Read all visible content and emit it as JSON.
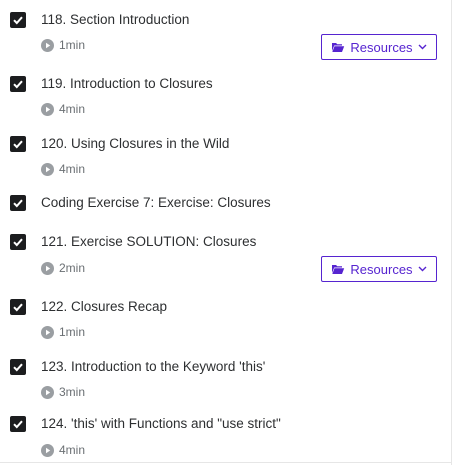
{
  "colors": {
    "checkbox": "#1c1d1f",
    "accent": "#5624d0",
    "muted": "#6a6f73",
    "text": "#2d2f31"
  },
  "resources_label": "Resources",
  "items": [
    {
      "title": "118. Section Introduction",
      "duration": "1min",
      "has_resources": true
    },
    {
      "title": "119. Introduction to Closures",
      "duration": "4min",
      "has_resources": false
    },
    {
      "title": "120. Using Closures in the Wild",
      "duration": "4min",
      "has_resources": false
    },
    {
      "title": "Coding Exercise 7: Exercise: Closures",
      "duration": "",
      "has_resources": false
    },
    {
      "title": "121. Exercise SOLUTION: Closures",
      "duration": "2min",
      "has_resources": true
    },
    {
      "title": "122. Closures Recap",
      "duration": "1min",
      "has_resources": false
    },
    {
      "title": "123. Introduction to the Keyword 'this'",
      "duration": "3min",
      "has_resources": false
    },
    {
      "title": "124. 'this' with Functions and \"use strict\"",
      "duration": "4min",
      "has_resources": false
    }
  ]
}
